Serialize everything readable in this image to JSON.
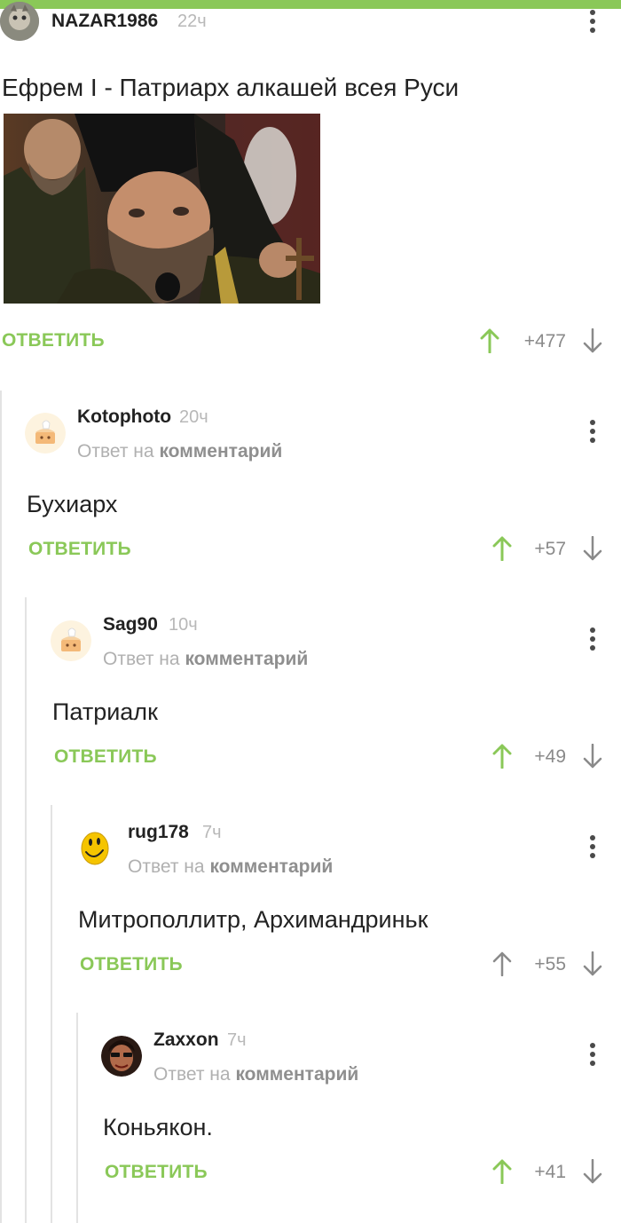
{
  "post": {
    "author": "NAZAR1986",
    "time": "22ч",
    "title": "Ефрем I - Патриарх алкашей всея Руси",
    "reply_label": "ОТВЕТИТЬ",
    "score": "+477"
  },
  "comments": [
    {
      "author": "Kotophoto",
      "time": "20ч",
      "reply_prefix": "Ответ на",
      "reply_link": "комментарий",
      "text": "Бухиарх",
      "reply_label": "ОТВЕТИТЬ",
      "score": "+57",
      "avatar": "default-cake-avatar"
    },
    {
      "author": "Sag90",
      "time": "10ч",
      "reply_prefix": "Ответ на",
      "reply_link": "комментарий",
      "text": "Патриалк",
      "reply_label": "ОТВЕТИТЬ",
      "score": "+49",
      "avatar": "default-cake-avatar"
    },
    {
      "author": "rug178",
      "time": "7ч",
      "reply_prefix": "Ответ на",
      "reply_link": "комментарий",
      "text": "Митрополлитр, Архимандриньк",
      "reply_label": "ОТВЕТИТЬ",
      "score": "+55",
      "avatar": "smiley-avatar"
    },
    {
      "author": "Zaxxon",
      "time": "7ч",
      "reply_prefix": "Ответ на",
      "reply_link": "комментарий",
      "text": "Коньякон.",
      "reply_label": "ОТВЕТИТЬ",
      "score": "+41",
      "avatar": "photo-avatar"
    }
  ],
  "colors": {
    "accent": "#8ac858",
    "upvote": "#8ac858",
    "muted": "#b0b0b0"
  },
  "icons": [
    "more-vertical-icon",
    "upvote-arrow-icon",
    "downvote-arrow-icon"
  ]
}
